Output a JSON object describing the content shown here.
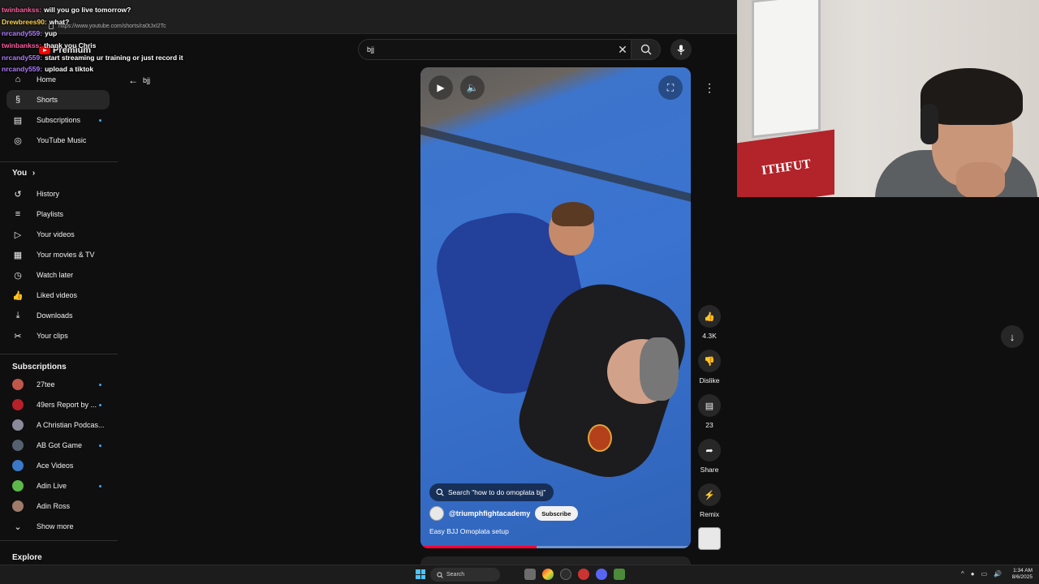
{
  "browser": {
    "url": "https://www.youtube.com/shorts/ra0tJxI2Tc"
  },
  "chat": [
    {
      "user": "twinbankss:",
      "message": "will you go live tomorrow?",
      "color": "#ff5fa0"
    },
    {
      "user": "Drewbrees90:",
      "message": "what?",
      "color": "#ffd24a"
    },
    {
      "user": "nrcandy559:",
      "message": "yup",
      "color": "#b07cff"
    },
    {
      "user": "twinbankss:",
      "message": "thank you Chris",
      "color": "#ff5fa0"
    },
    {
      "user": "nrcandy559:",
      "message": "start streaming ur training or just record it",
      "color": "#b07cff"
    },
    {
      "user": "nrcandy559:",
      "message": "upload a tiktok",
      "color": "#b07cff"
    }
  ],
  "logo": {
    "text": "Premium"
  },
  "sidebar": {
    "main": [
      {
        "label": "Home",
        "icon": "home-icon",
        "glyph": "⌂"
      },
      {
        "label": "Shorts",
        "icon": "shorts-icon",
        "glyph": "§",
        "active": true
      },
      {
        "label": "Subscriptions",
        "icon": "subscriptions-icon",
        "glyph": "▤",
        "dot": true
      },
      {
        "label": "YouTube Music",
        "icon": "music-icon",
        "glyph": "◎"
      }
    ],
    "you_title": "You",
    "you": [
      {
        "label": "History",
        "icon": "history-icon",
        "glyph": "↺"
      },
      {
        "label": "Playlists",
        "icon": "playlists-icon",
        "glyph": "≡"
      },
      {
        "label": "Your videos",
        "icon": "your-videos-icon",
        "glyph": "▷"
      },
      {
        "label": "Your movies & TV",
        "icon": "movies-icon",
        "glyph": "▦"
      },
      {
        "label": "Watch later",
        "icon": "watch-later-icon",
        "glyph": "◷"
      },
      {
        "label": "Liked videos",
        "icon": "liked-icon",
        "glyph": "👍"
      },
      {
        "label": "Downloads",
        "icon": "downloads-icon",
        "glyph": "⤓"
      },
      {
        "label": "Your clips",
        "icon": "clips-icon",
        "glyph": "✂"
      }
    ],
    "subscriptions_title": "Subscriptions",
    "subscriptions": [
      {
        "label": "27tee",
        "color": "#c0574a",
        "dot": true
      },
      {
        "label": "49ers Report by ...",
        "color": "#b8202a",
        "dot": true
      },
      {
        "label": "A Christian Podcas...",
        "color": "#8a8a9a",
        "dot": false
      },
      {
        "label": "AB Got Game",
        "color": "#556070",
        "dot": true
      },
      {
        "label": "Ace Videos",
        "color": "#3a78c8",
        "dot": false
      },
      {
        "label": "Adin Live",
        "color": "#5db84a",
        "dot": true
      },
      {
        "label": "Adin Ross",
        "color": "#a07a6a",
        "dot": false
      }
    ],
    "show_more": "Show more",
    "explore_title": "Explore"
  },
  "back": {
    "label": "bjj"
  },
  "search": {
    "value": "bjj",
    "placeholder": "Search"
  },
  "video": {
    "search_pill": "Search \"how to do omoplata bjj\"",
    "channel": "@triumphfightacademy",
    "subscribe": "Subscribe",
    "title": "Easy BJJ Omoplata setup",
    "progress": 0.43
  },
  "actions": {
    "like_count": "4.3K",
    "dislike": "Dislike",
    "comments": "23",
    "share": "Share",
    "remix": "Remix"
  },
  "webcam": {
    "flag_text": "ITHFUT"
  },
  "taskbar": {
    "search_label": "Search",
    "time": "1:34 AM",
    "date": "8/6/2025"
  }
}
